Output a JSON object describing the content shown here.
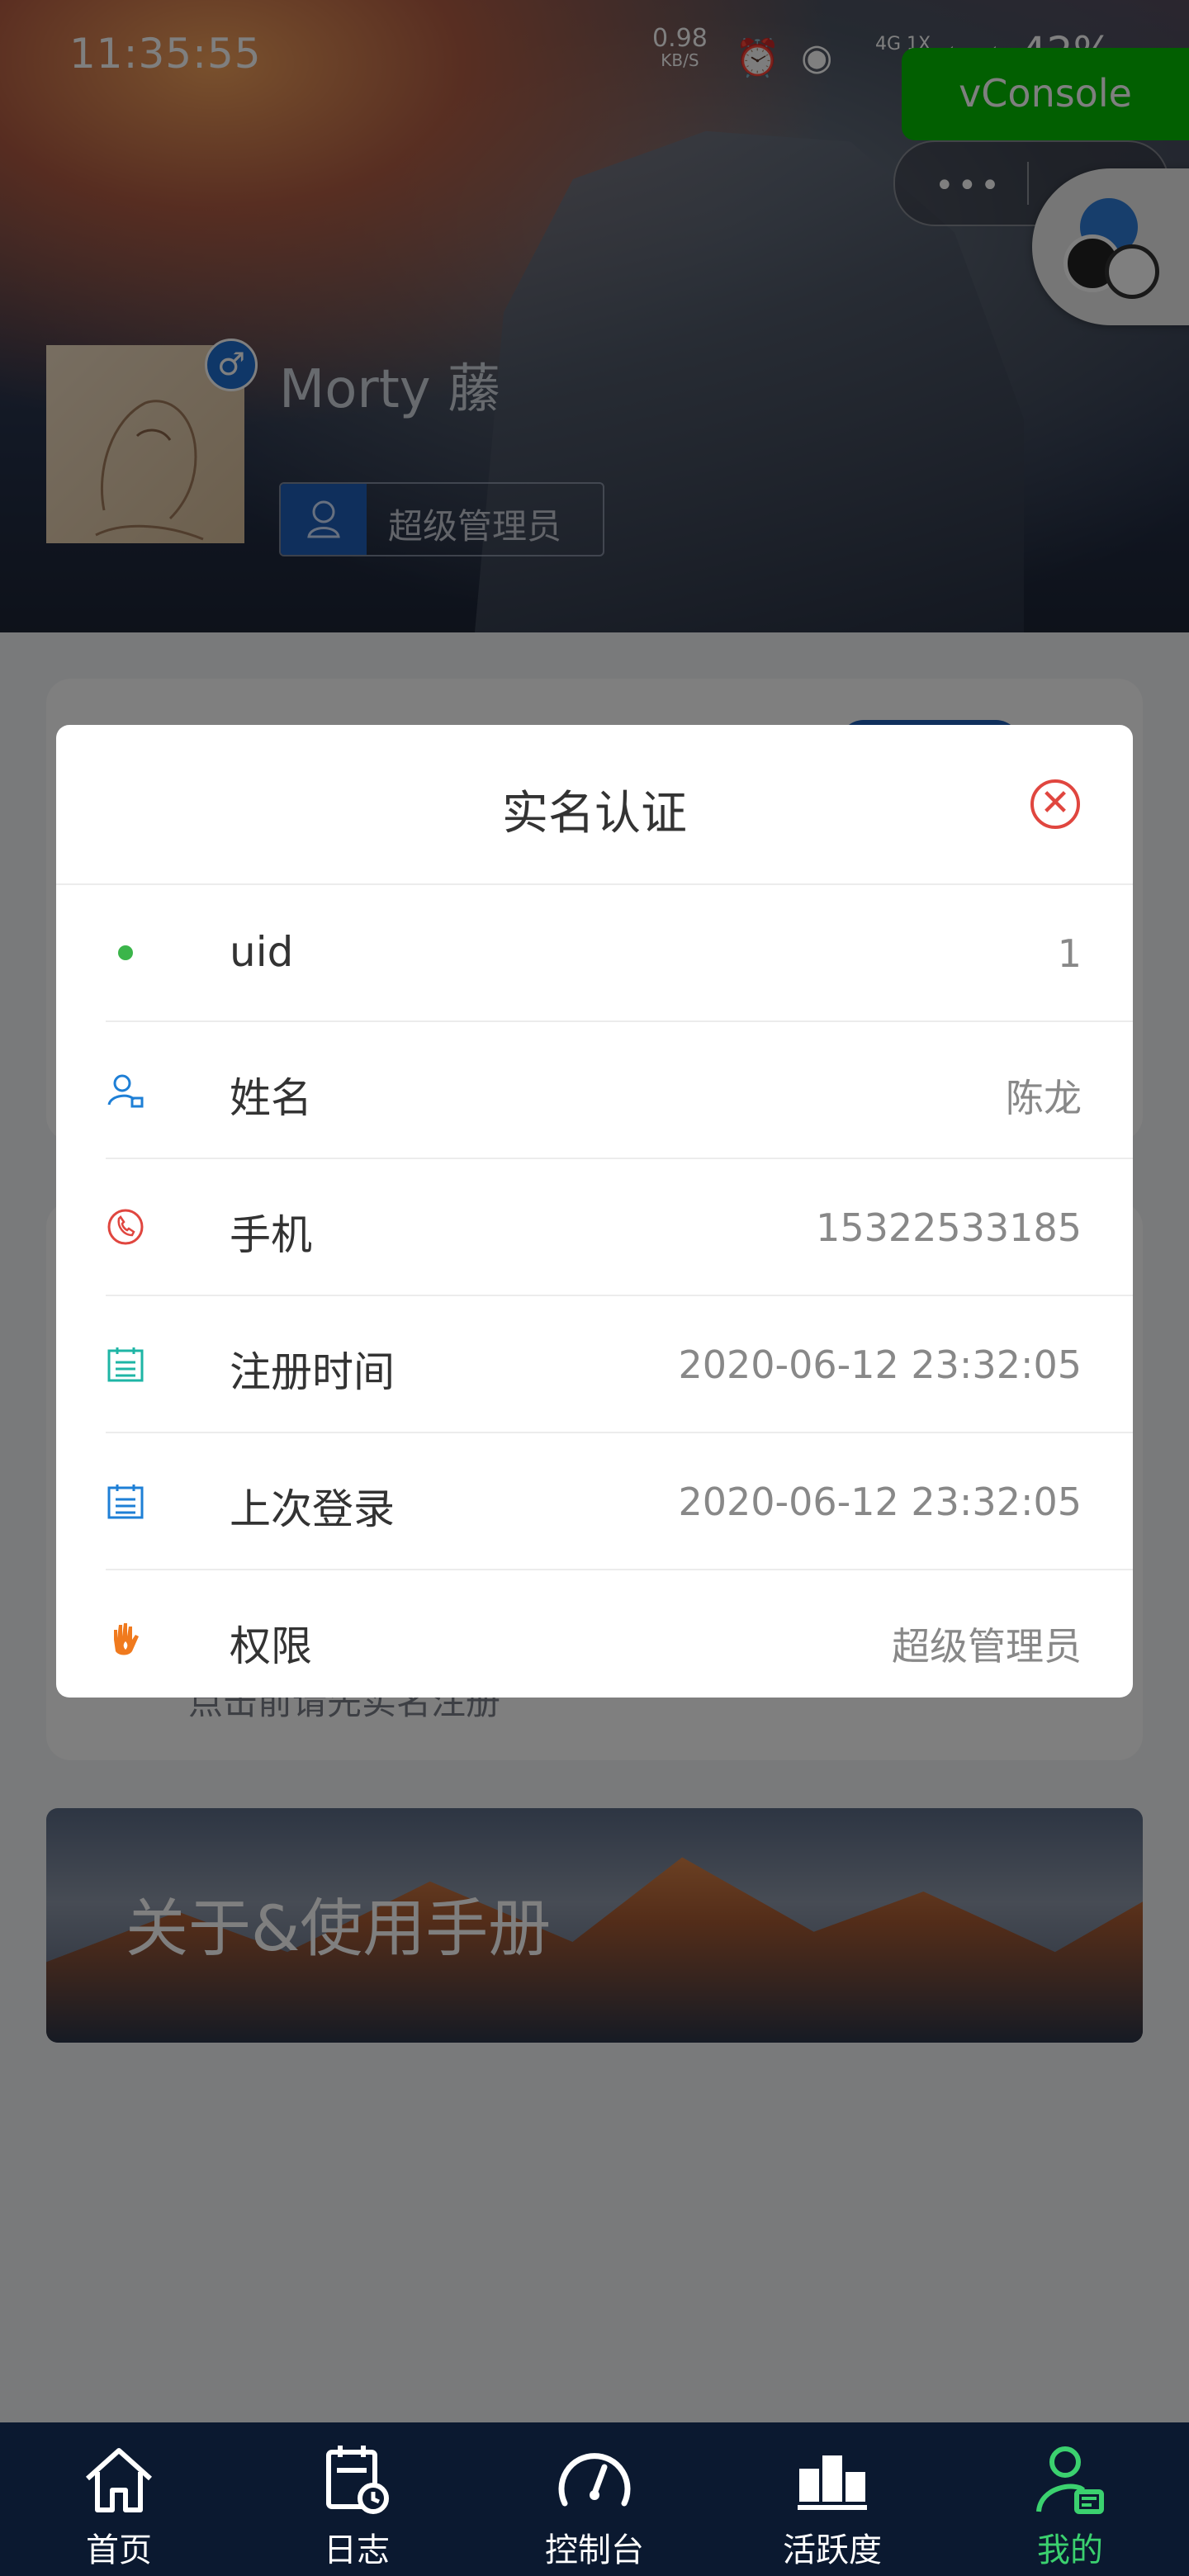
{
  "status_bar": {
    "time": "11:35:55",
    "net_speed": "0.98",
    "net_unit": "KB/S",
    "signal": "4G 1X",
    "battery": "42%"
  },
  "vconsole": {
    "label": "vConsole"
  },
  "capsule": {
    "more_label": "•••"
  },
  "profile": {
    "username": "Morty 䕨",
    "gender_symbol": "♂",
    "role": "超级管理员"
  },
  "background": {
    "hint_text": "点击前请先实名注册",
    "about_text": "关于&使用手册"
  },
  "modal": {
    "title": "实名认证",
    "close_symbol": "✕",
    "rows": [
      {
        "label": "uid",
        "value": "1",
        "icon": "green-dot-icon"
      },
      {
        "label": "姓名",
        "value": "陈龙",
        "icon": "user-card-icon"
      },
      {
        "label": "手机",
        "value": "15322533185",
        "icon": "phone-icon"
      },
      {
        "label": "注册时间",
        "value": "2020-06-12 23:32:05",
        "icon": "calendar-teal-icon"
      },
      {
        "label": "上次登录",
        "value": "2020-06-12 23:32:05",
        "icon": "calendar-blue-icon"
      },
      {
        "label": "权限",
        "value": "超级管理员",
        "icon": "hand-icon"
      }
    ]
  },
  "tabbar": {
    "items": [
      {
        "label": "首页",
        "icon": "home-icon",
        "active": false
      },
      {
        "label": "日志",
        "icon": "log-calendar-icon",
        "active": false
      },
      {
        "label": "控制台",
        "icon": "speedometer-icon",
        "active": false
      },
      {
        "label": "活跃度",
        "icon": "podium-icon",
        "active": false
      },
      {
        "label": "我的",
        "icon": "profile-icon",
        "active": true
      }
    ]
  },
  "colors": {
    "accent_green": "#3bd16f",
    "close_red": "#e0463f",
    "tabbar_bg": "#0b1930",
    "vconsole_green": "#04be02"
  }
}
